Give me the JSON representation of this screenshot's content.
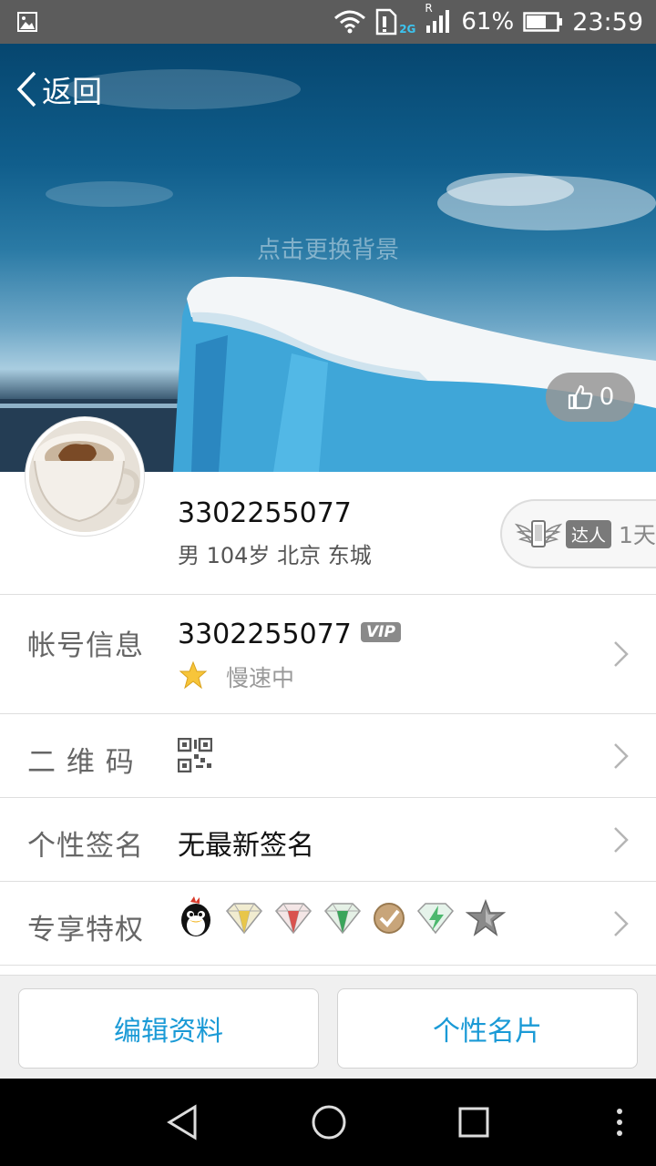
{
  "status_bar": {
    "network": "2G",
    "roaming": "R",
    "battery": "61%",
    "time": "23:59"
  },
  "header": {
    "back_label": "返回",
    "change_background": "点击更换背景",
    "like_count": "0"
  },
  "profile": {
    "name": "3302255077",
    "details": "男 104岁 北京 东城",
    "daren_tag": "达人",
    "daren_days": "1天"
  },
  "rows": {
    "account": {
      "label": "帐号信息",
      "value": "3302255077",
      "vip": "VIP",
      "speed": "慢速中"
    },
    "qrcode": {
      "label": "二 维 码"
    },
    "signature": {
      "label": "个性签名",
      "value": "无最新签名"
    },
    "privileges": {
      "label": "专享特权"
    }
  },
  "buttons": {
    "edit_profile": "编辑资料",
    "business_card": "个性名片"
  },
  "colors": {
    "accent": "#1a9ad6",
    "status_bar": "#5c5c5c",
    "label_gray": "#666666"
  }
}
